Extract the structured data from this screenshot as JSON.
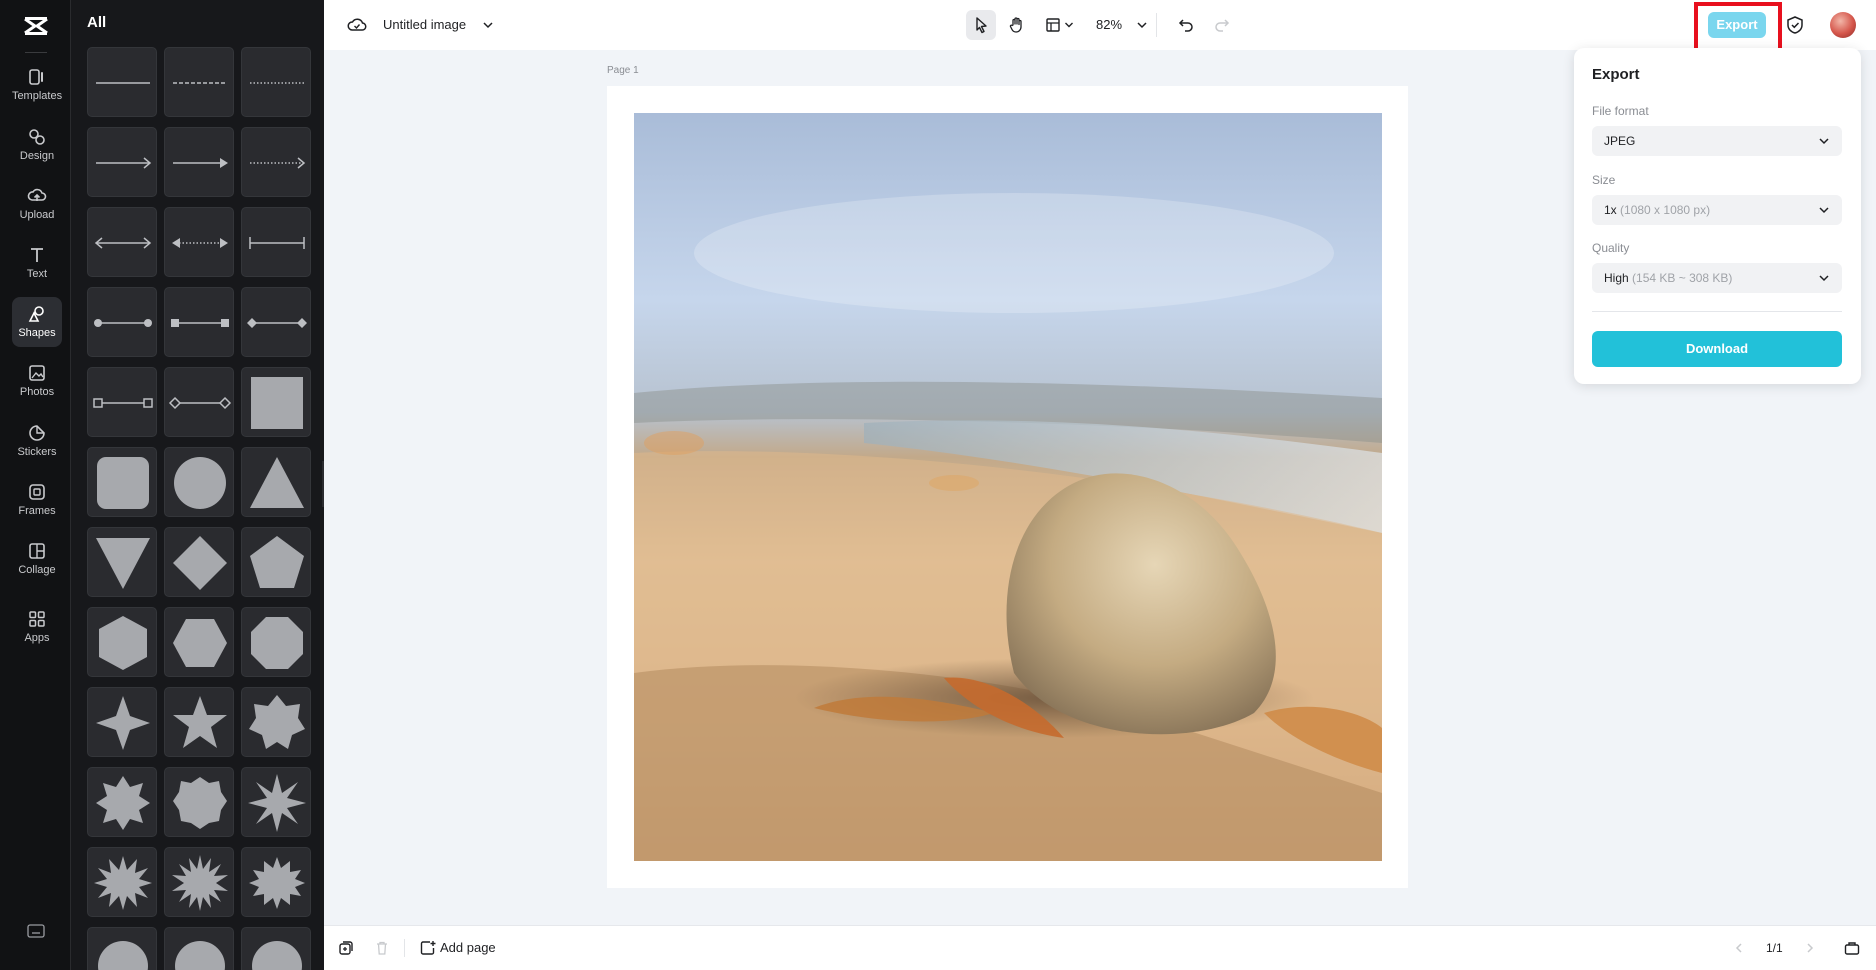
{
  "app": {
    "document_title": "Untitled image"
  },
  "rail": {
    "items": [
      {
        "label": "Templates",
        "icon": "templates-icon"
      },
      {
        "label": "Design",
        "icon": "design-icon"
      },
      {
        "label": "Upload",
        "icon": "upload-icon"
      },
      {
        "label": "Text",
        "icon": "text-icon"
      },
      {
        "label": "Shapes",
        "icon": "shapes-icon",
        "active": true
      },
      {
        "label": "Photos",
        "icon": "photos-icon"
      },
      {
        "label": "Stickers",
        "icon": "stickers-icon"
      },
      {
        "label": "Frames",
        "icon": "frames-icon"
      },
      {
        "label": "Collage",
        "icon": "collage-icon"
      },
      {
        "label": "Apps",
        "icon": "apps-icon"
      }
    ]
  },
  "panel": {
    "title": "All",
    "shapes": [
      "line-solid",
      "line-dashed",
      "line-dotted",
      "arrow-solid",
      "arrow-filled",
      "arrow-dotted",
      "arrow-double",
      "arrow-double-dotted",
      "line-bar-ends",
      "line-circle-ends",
      "line-square-ends",
      "line-diamond-ends",
      "line-square-outline-ends",
      "line-diamond-outline-ends",
      "square",
      "rounded-square",
      "circle",
      "triangle",
      "inverted-triangle",
      "diamond",
      "pentagon",
      "hexagon",
      "hexagon-flat",
      "octagon",
      "star-4",
      "star-5",
      "star-7",
      "starburst-8",
      "starburst-9",
      "star-8",
      "starburst-12",
      "starburst-16",
      "starburst-14",
      "burst-a",
      "burst-b",
      "burst-c"
    ]
  },
  "toolbar": {
    "zoom": "82%",
    "export_label": "Export"
  },
  "canvas": {
    "page_label": "Page 1"
  },
  "export": {
    "title": "Export",
    "file_format_label": "File format",
    "file_format_value": "JPEG",
    "size_label": "Size",
    "size_value": "1x",
    "size_hint": "(1080 x 1080 px)",
    "quality_label": "Quality",
    "quality_value": "High",
    "quality_hint": "(154 KB ~ 308 KB)",
    "download_label": "Download"
  },
  "bottombar": {
    "add_page_label": "Add page",
    "page_count": "1/1"
  },
  "colors": {
    "accent": "#22c1d9",
    "export_button": "#7ad6ee",
    "highlight": "#e8101e"
  }
}
